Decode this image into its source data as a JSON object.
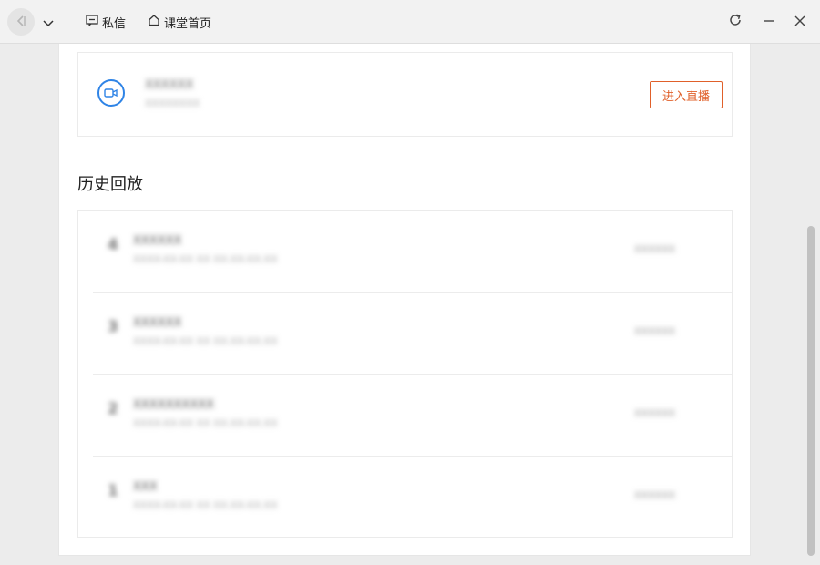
{
  "topbar": {
    "messages_label": "私信",
    "home_label": "课堂首页",
    "icons": {
      "back": "back-icon",
      "dropdown": "chevron-down-icon",
      "messages": "message-icon",
      "home": "home-icon",
      "refresh": "refresh-icon",
      "minimize": "minimize-icon",
      "close": "close-icon"
    }
  },
  "live": {
    "title": "XXXXXX",
    "subtitle": "XXXXXXXX",
    "enter_label": "进入直播",
    "accent_color": "#2f84e6",
    "button_color": "#e0602a"
  },
  "history": {
    "title": "历史回放",
    "rows": [
      {
        "num": "4",
        "title": "XXXXXX",
        "time": "XXXX-XX-XX XX XX:XX-XX:XX",
        "status": "XXXXXX"
      },
      {
        "num": "3",
        "title": "XXXXXX",
        "time": "XXXX-XX-XX XX XX:XX-XX:XX",
        "status": "XXXXXX"
      },
      {
        "num": "2",
        "title": "XXXXXXXXXX",
        "time": "XXXX-XX-XX XX XX:XX-XX:XX",
        "status": "XXXXXX"
      },
      {
        "num": "1",
        "title": "XXX",
        "time": "XXXX-XX-XX XX XX:XX-XX:XX",
        "status": "XXXXXX"
      }
    ]
  }
}
